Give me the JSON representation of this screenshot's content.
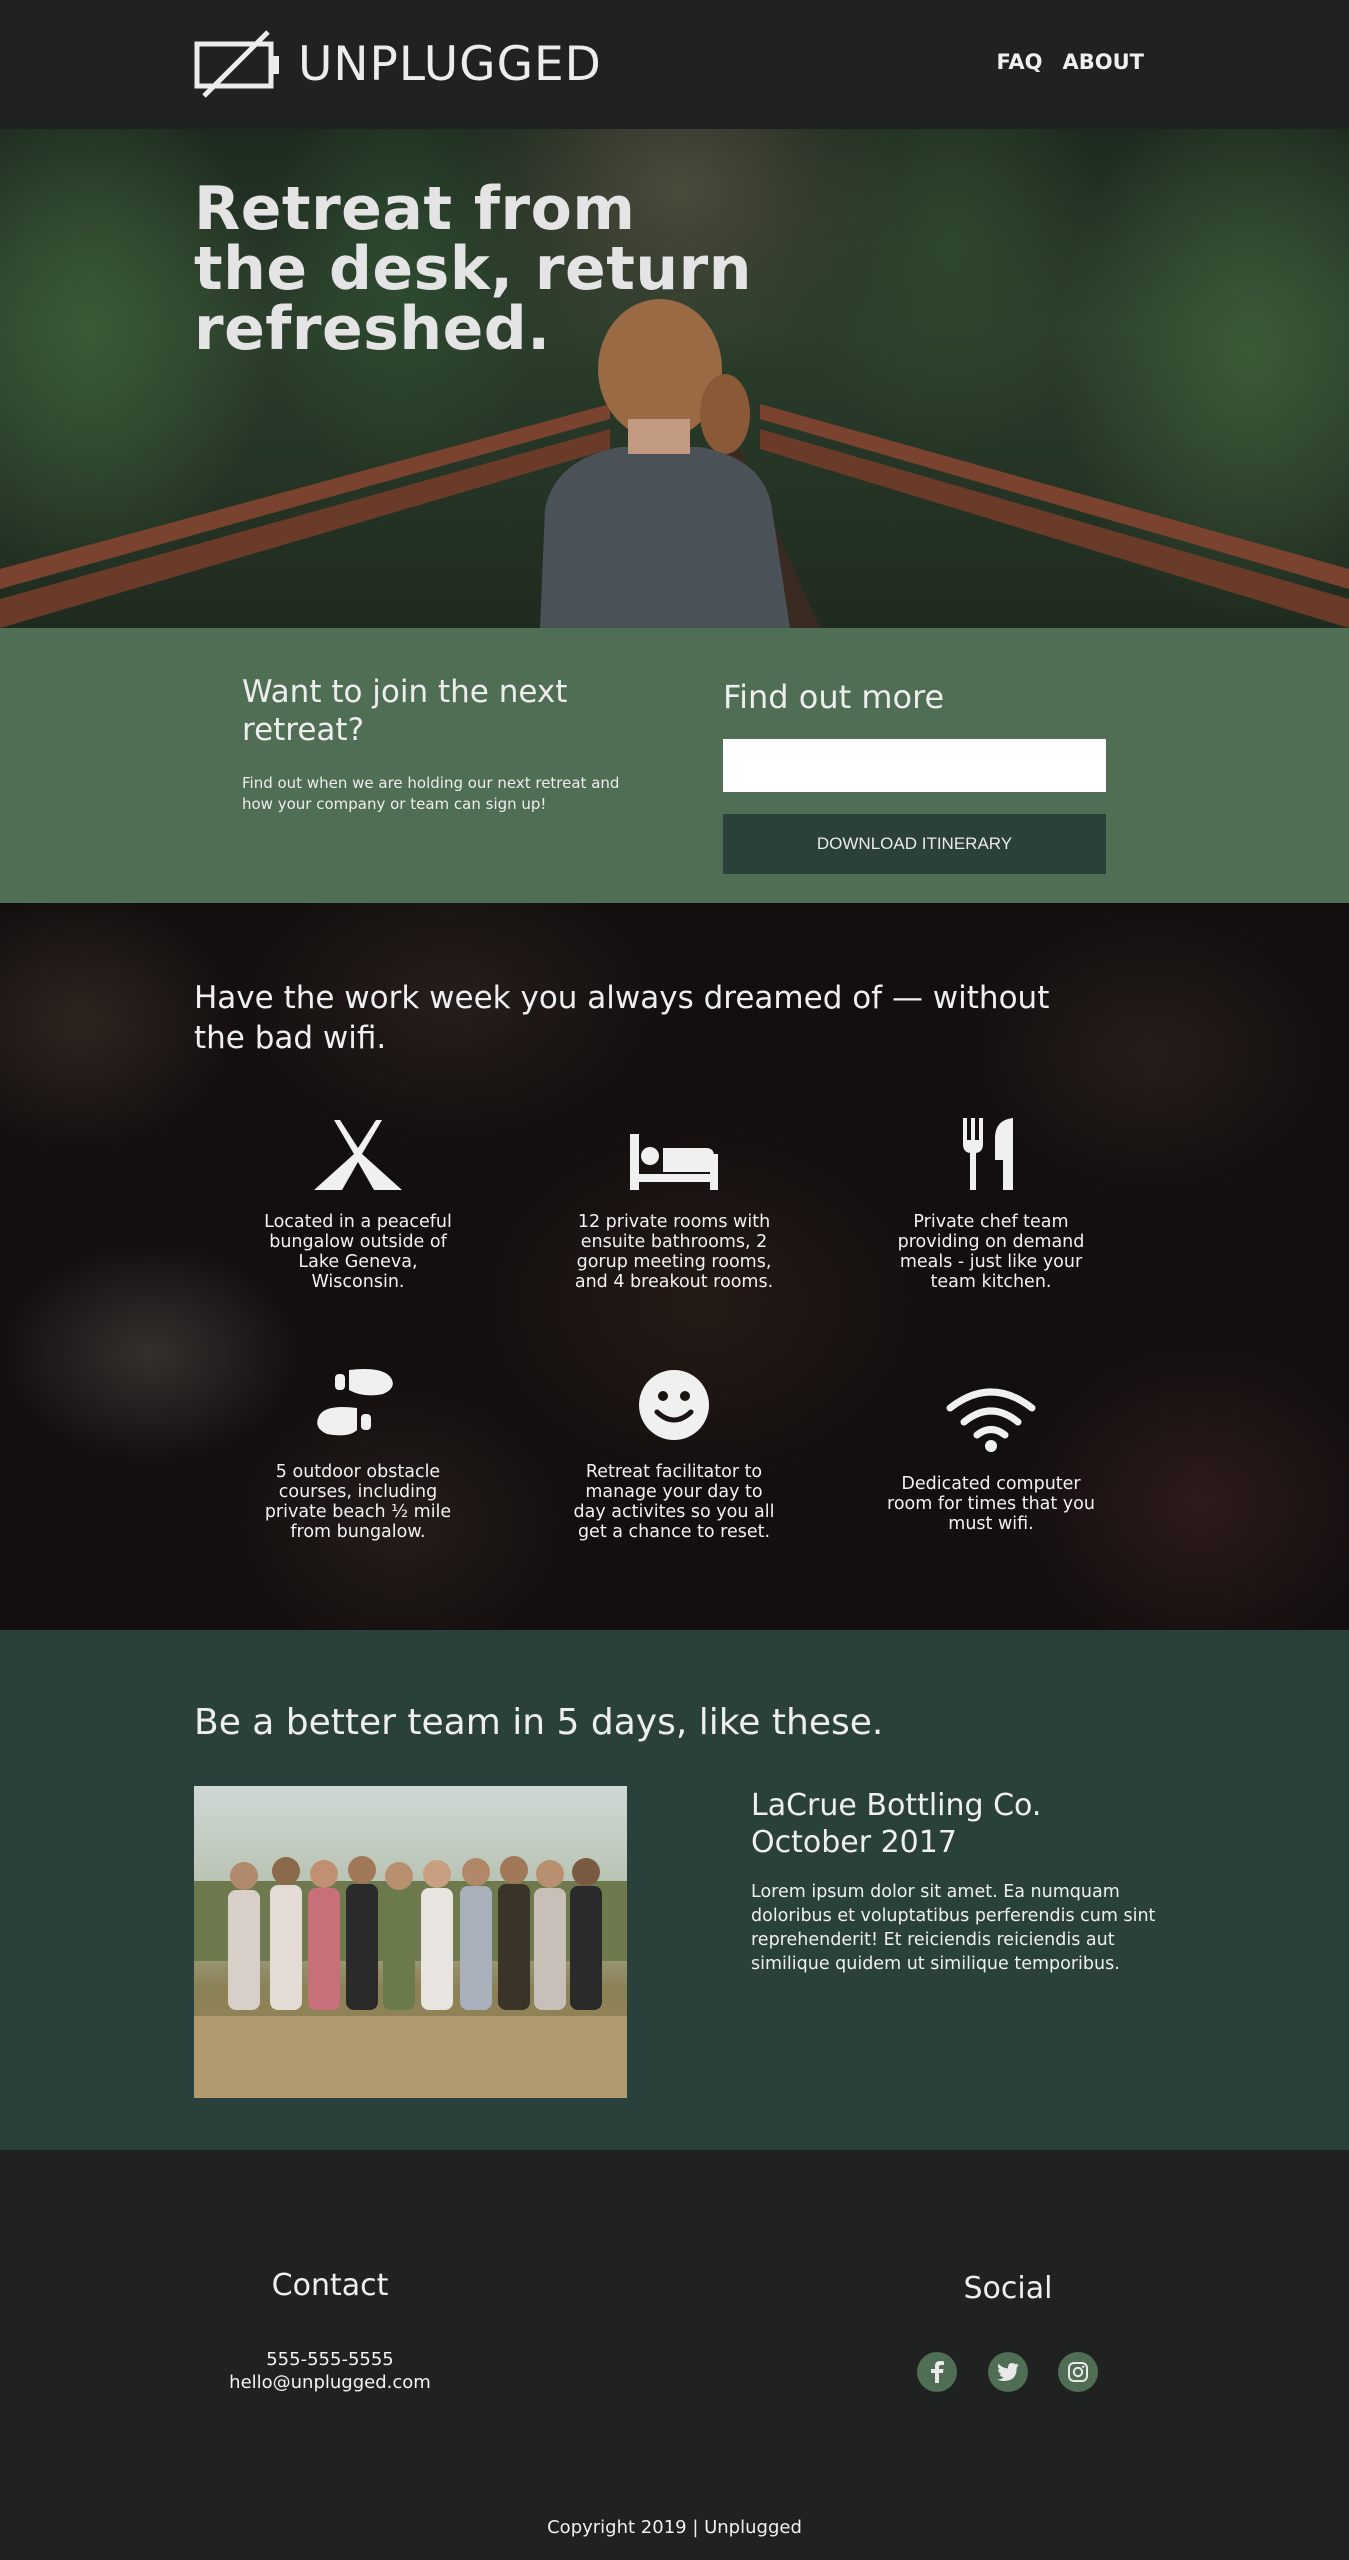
{
  "header": {
    "brand": "UNPLUGGED",
    "nav": [
      "FAQ",
      "ABOUT"
    ]
  },
  "hero": {
    "title": "Retreat from the desk, return refreshed."
  },
  "join": {
    "heading": "Want to join the next retreat?",
    "text": "Find out when we are holding our next retreat and how your company or team can sign up!",
    "form_heading": "Find out more",
    "input_value": "",
    "button": "DOWNLOAD ITINERARY"
  },
  "features": {
    "heading": "Have the work week you always dreamed of — without the bad wifi.",
    "items": [
      {
        "icon": "tent-icon",
        "text": "Located in a peaceful bungalow outside of Lake Geneva, Wisconsin."
      },
      {
        "icon": "bed-icon",
        "text": "12 private rooms with ensuite bathrooms, 2 gorup meeting rooms, and 4 breakout rooms."
      },
      {
        "icon": "utensils-icon",
        "text": "Private chef team providing on demand meals - just like your team kitchen."
      },
      {
        "icon": "footprints-icon",
        "text": "5 outdoor obstacle courses, including private beach ½ mile from bungalow."
      },
      {
        "icon": "smile-icon",
        "text": "Retreat facilitator to manage your day to day activites so you all get a chance to reset."
      },
      {
        "icon": "wifi-icon",
        "text": "Dedicated computer room for times that you must wifi."
      }
    ]
  },
  "team": {
    "heading": "Be a better team in 5 days, like these.",
    "case_title": "LaCrue Bottling Co. October 2017",
    "case_text": "Lorem ipsum dolor sit amet. Ea numquam doloribus et voluptatibus perferendis cum sint reprehenderit! Et reiciendis reiciendis aut similique quidem ut similique temporibus."
  },
  "footer": {
    "contact_heading": "Contact",
    "phone": "555-555-5555",
    "email": "hello@unplugged.com",
    "social_heading": "Social",
    "social_icons": [
      "facebook-icon",
      "twitter-icon",
      "instagram-icon"
    ],
    "copyright": "Copyright 2019 | Unplugged"
  },
  "colors": {
    "header_bg": "#202121",
    "join_bg": "#506e53",
    "button_bg": "#2a4038",
    "team_bg": "#29413a",
    "footer_bg": "#202121"
  }
}
